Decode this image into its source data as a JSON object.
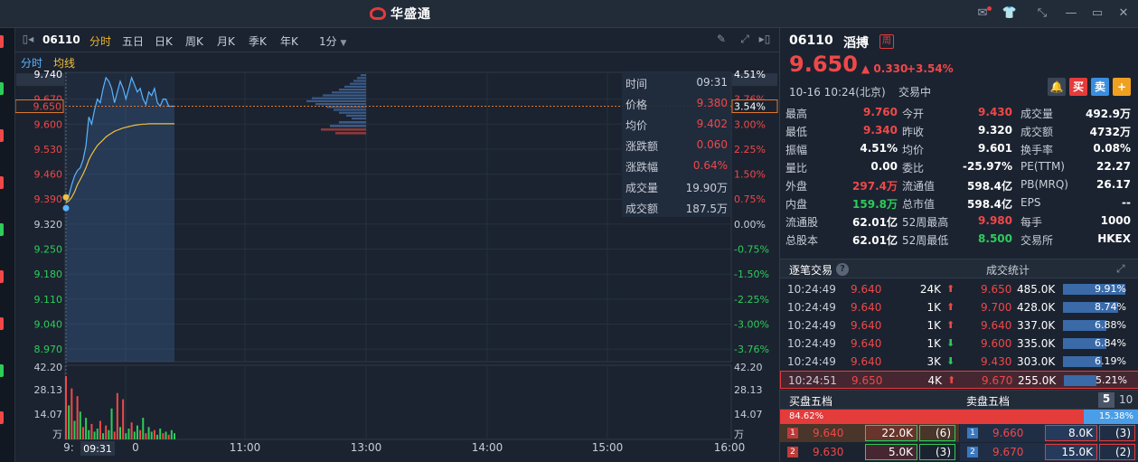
{
  "app": {
    "title": "华盛通"
  },
  "toolbar": {
    "code": "06110",
    "periods": [
      "分时",
      "五日",
      "日K",
      "周K",
      "月K",
      "季K",
      "年K",
      "1分"
    ],
    "active_period": "分时"
  },
  "subtabs": {
    "timeshare": "分时",
    "avg": "均线"
  },
  "chart_data": {
    "type": "line",
    "prev_close": 9.32,
    "y_ticks": [
      "9.740",
      "9.670",
      "9.600",
      "9.530",
      "9.460",
      "9.390",
      "9.320",
      "9.250",
      "9.180",
      "9.110",
      "9.040",
      "8.970"
    ],
    "y_pct_ticks": [
      "4.51%",
      "3.76%",
      "3.00%",
      "2.25%",
      "1.50%",
      "0.75%",
      "0.00%",
      "-0.75%",
      "-1.50%",
      "-2.25%",
      "-3.00%",
      "-3.76%"
    ],
    "ylim": [
      8.935,
      9.745
    ],
    "x_ticks": [
      "9:",
      "0",
      "11:00",
      "13:00",
      "14:00",
      "15:00",
      "16:00"
    ],
    "cursor_time": "09:31",
    "current_price_label": "9.650",
    "current_pct_label": "3.54%",
    "volume_ticks": [
      "42.20",
      "28.13",
      "14.07"
    ],
    "volume_unit": "万",
    "price_series": [
      9.38,
      9.4,
      9.43,
      9.455,
      9.47,
      9.478,
      9.5,
      9.54,
      9.62,
      9.6,
      9.64,
      9.67,
      9.66,
      9.7,
      9.73,
      9.72,
      9.7,
      9.66,
      9.69,
      9.72,
      9.7,
      9.67,
      9.7,
      9.73,
      9.71,
      9.69,
      9.7,
      9.67,
      9.655,
      9.69,
      9.68,
      9.7,
      9.66,
      9.65,
      9.67,
      9.67,
      9.65,
      9.65,
      9.65
    ],
    "avg_series": [
      9.38,
      9.385,
      9.395,
      9.41,
      9.43,
      9.445,
      9.46,
      9.478,
      9.5,
      9.515,
      9.528,
      9.54,
      9.548,
      9.556,
      9.564,
      9.57,
      9.575,
      9.58,
      9.583,
      9.586,
      9.589,
      9.591,
      9.593,
      9.595,
      9.597,
      9.598,
      9.599,
      9.6,
      9.6,
      9.601,
      9.601,
      9.601,
      9.601,
      9.601,
      9.601,
      9.601,
      9.601,
      9.601,
      9.601
    ],
    "volume_series": [
      41,
      22,
      33,
      12,
      28,
      18,
      8,
      14,
      6,
      10,
      5,
      7,
      12,
      4,
      9,
      6,
      20,
      5,
      30,
      8,
      26,
      4,
      7,
      11,
      5,
      9,
      6,
      14,
      4,
      8,
      5,
      6,
      3,
      7,
      4,
      5,
      3,
      6,
      4
    ],
    "volume_up": [
      false,
      true,
      false,
      true,
      false,
      true,
      false,
      true,
      true,
      false,
      true,
      true,
      false,
      true,
      false,
      true,
      true,
      false,
      false,
      true,
      false,
      true,
      true,
      false,
      true,
      true,
      false,
      true,
      false,
      true,
      true,
      false,
      true,
      true,
      false,
      true,
      false,
      true,
      true
    ],
    "ylim_volume": [
      0,
      48
    ]
  },
  "tooltip": {
    "rows": [
      {
        "k": "时间",
        "v": "09:31",
        "color": "#c8ced8"
      },
      {
        "k": "价格",
        "v": "9.380",
        "color": "#f04848"
      },
      {
        "k": "均价",
        "v": "9.402",
        "color": "#f04848"
      },
      {
        "k": "涨跌额",
        "v": "0.060",
        "color": "#f04848"
      },
      {
        "k": "涨跌幅",
        "v": "0.64%",
        "color": "#f04848"
      },
      {
        "k": "成交量",
        "v": "19.90万",
        "color": "#c8ced8"
      },
      {
        "k": "成交额",
        "v": "187.5万",
        "color": "#c8ced8"
      }
    ]
  },
  "quote": {
    "code": "06110",
    "name": "滔搏",
    "badge": "周",
    "price": "9.650",
    "change": "0.330",
    "change_pct": "+3.54%",
    "datetime": "10-16  10:24(北京)",
    "status": "交易中",
    "buy_label": "买",
    "sell_label": "卖",
    "add_label": "+"
  },
  "stats": [
    {
      "k": "最高",
      "v": "9.760",
      "c": "#f04848"
    },
    {
      "k": "今开",
      "v": "9.430",
      "c": "#f04848"
    },
    {
      "k": "成交量",
      "v": "492.9万",
      "c": "#ffffff"
    },
    {
      "k": "最低",
      "v": "9.340",
      "c": "#f04848"
    },
    {
      "k": "昨收",
      "v": "9.320",
      "c": "#ffffff"
    },
    {
      "k": "成交额",
      "v": "4732万",
      "c": "#ffffff"
    },
    {
      "k": "振幅",
      "v": "4.51%",
      "c": "#ffffff"
    },
    {
      "k": "均价",
      "v": "9.601",
      "c": "#ffffff"
    },
    {
      "k": "换手率",
      "v": "0.08%",
      "c": "#ffffff"
    },
    {
      "k": "量比",
      "v": "0.00",
      "c": "#ffffff"
    },
    {
      "k": "委比",
      "v": "-25.97%",
      "c": "#ffffff"
    },
    {
      "k": "PE(TTM)",
      "v": "22.27",
      "c": "#ffffff"
    },
    {
      "k": "外盘",
      "v": "297.4万",
      "c": "#f04848"
    },
    {
      "k": "流通值",
      "v": "598.4亿",
      "c": "#ffffff"
    },
    {
      "k": "PB(MRQ)",
      "v": "26.17",
      "c": "#ffffff"
    },
    {
      "k": "内盘",
      "v": "159.8万",
      "c": "#2ecc5a"
    },
    {
      "k": "总市值",
      "v": "598.4亿",
      "c": "#ffffff"
    },
    {
      "k": "EPS",
      "v": "--",
      "c": "#ffffff"
    },
    {
      "k": "流通股",
      "v": "62.01亿",
      "c": "#ffffff"
    },
    {
      "k": "52周最高",
      "v": "9.980",
      "c": "#f04848"
    },
    {
      "k": "每手",
      "v": "1000",
      "c": "#ffffff"
    },
    {
      "k": "总股本",
      "v": "62.01亿",
      "c": "#ffffff"
    },
    {
      "k": "52周最低",
      "v": "8.500",
      "c": "#2ecc5a"
    },
    {
      "k": "交易所",
      "v": "HKEX",
      "c": "#ffffff"
    }
  ],
  "ticks_section": {
    "title": "逐笔交易",
    "stats_title": "成交统计"
  },
  "ticks": [
    {
      "time": "10:24:49",
      "price": "9.640",
      "vol": "24K",
      "dir": "up"
    },
    {
      "time": "10:24:49",
      "price": "9.640",
      "vol": "1K",
      "dir": "up"
    },
    {
      "time": "10:24:49",
      "price": "9.640",
      "vol": "1K",
      "dir": "up"
    },
    {
      "time": "10:24:49",
      "price": "9.640",
      "vol": "1K",
      "dir": "down"
    },
    {
      "time": "10:24:49",
      "price": "9.640",
      "vol": "3K",
      "dir": "down"
    },
    {
      "time": "10:24:51",
      "price": "9.650",
      "vol": "4K",
      "dir": "up"
    }
  ],
  "trade_stats": [
    {
      "price": "9.650",
      "vol": "485.0K",
      "pct": "9.91%",
      "frac": 0.99
    },
    {
      "price": "9.700",
      "vol": "428.0K",
      "pct": "8.74%",
      "frac": 0.87
    },
    {
      "price": "9.640",
      "vol": "337.0K",
      "pct": "6.88%",
      "frac": 0.69
    },
    {
      "price": "9.600",
      "vol": "335.0K",
      "pct": "6.84%",
      "frac": 0.68
    },
    {
      "price": "9.430",
      "vol": "303.0K",
      "pct": "6.19%",
      "frac": 0.62
    },
    {
      "price": "9.670",
      "vol": "255.0K",
      "pct": "5.21%",
      "frac": 0.52
    }
  ],
  "orderbook": {
    "bid_title": "买盘五档",
    "ask_title": "卖盘五档",
    "depth_5": "5",
    "depth_10": "10",
    "bid_pct": "84.62%",
    "ask_pct": "15.38%",
    "bid_frac": 0.8462,
    "bids": [
      {
        "n": "1",
        "price": "9.640",
        "vol": "22.0K",
        "cnt": "(6)"
      },
      {
        "n": "2",
        "price": "9.630",
        "vol": "5.0K",
        "cnt": "(3)"
      }
    ],
    "asks": [
      {
        "n": "1",
        "price": "9.660",
        "vol": "8.0K",
        "cnt": "(3)"
      },
      {
        "n": "2",
        "price": "9.670",
        "vol": "15.0K",
        "cnt": "(2)"
      }
    ]
  },
  "colors": {
    "up": "#f04848",
    "down": "#2ecc5a",
    "line": "#5ab4ff",
    "avg": "#f0c040",
    "accent": "#f0b429"
  },
  "icons": [
    "mail-icon",
    "shirt-icon",
    "shrink-icon",
    "minimize-icon",
    "close-icon",
    "panel-toggle-icon",
    "pen-icon",
    "expand-icon",
    "sidebar-icon",
    "help-icon",
    "expand-section-icon",
    "bell-icon"
  ]
}
